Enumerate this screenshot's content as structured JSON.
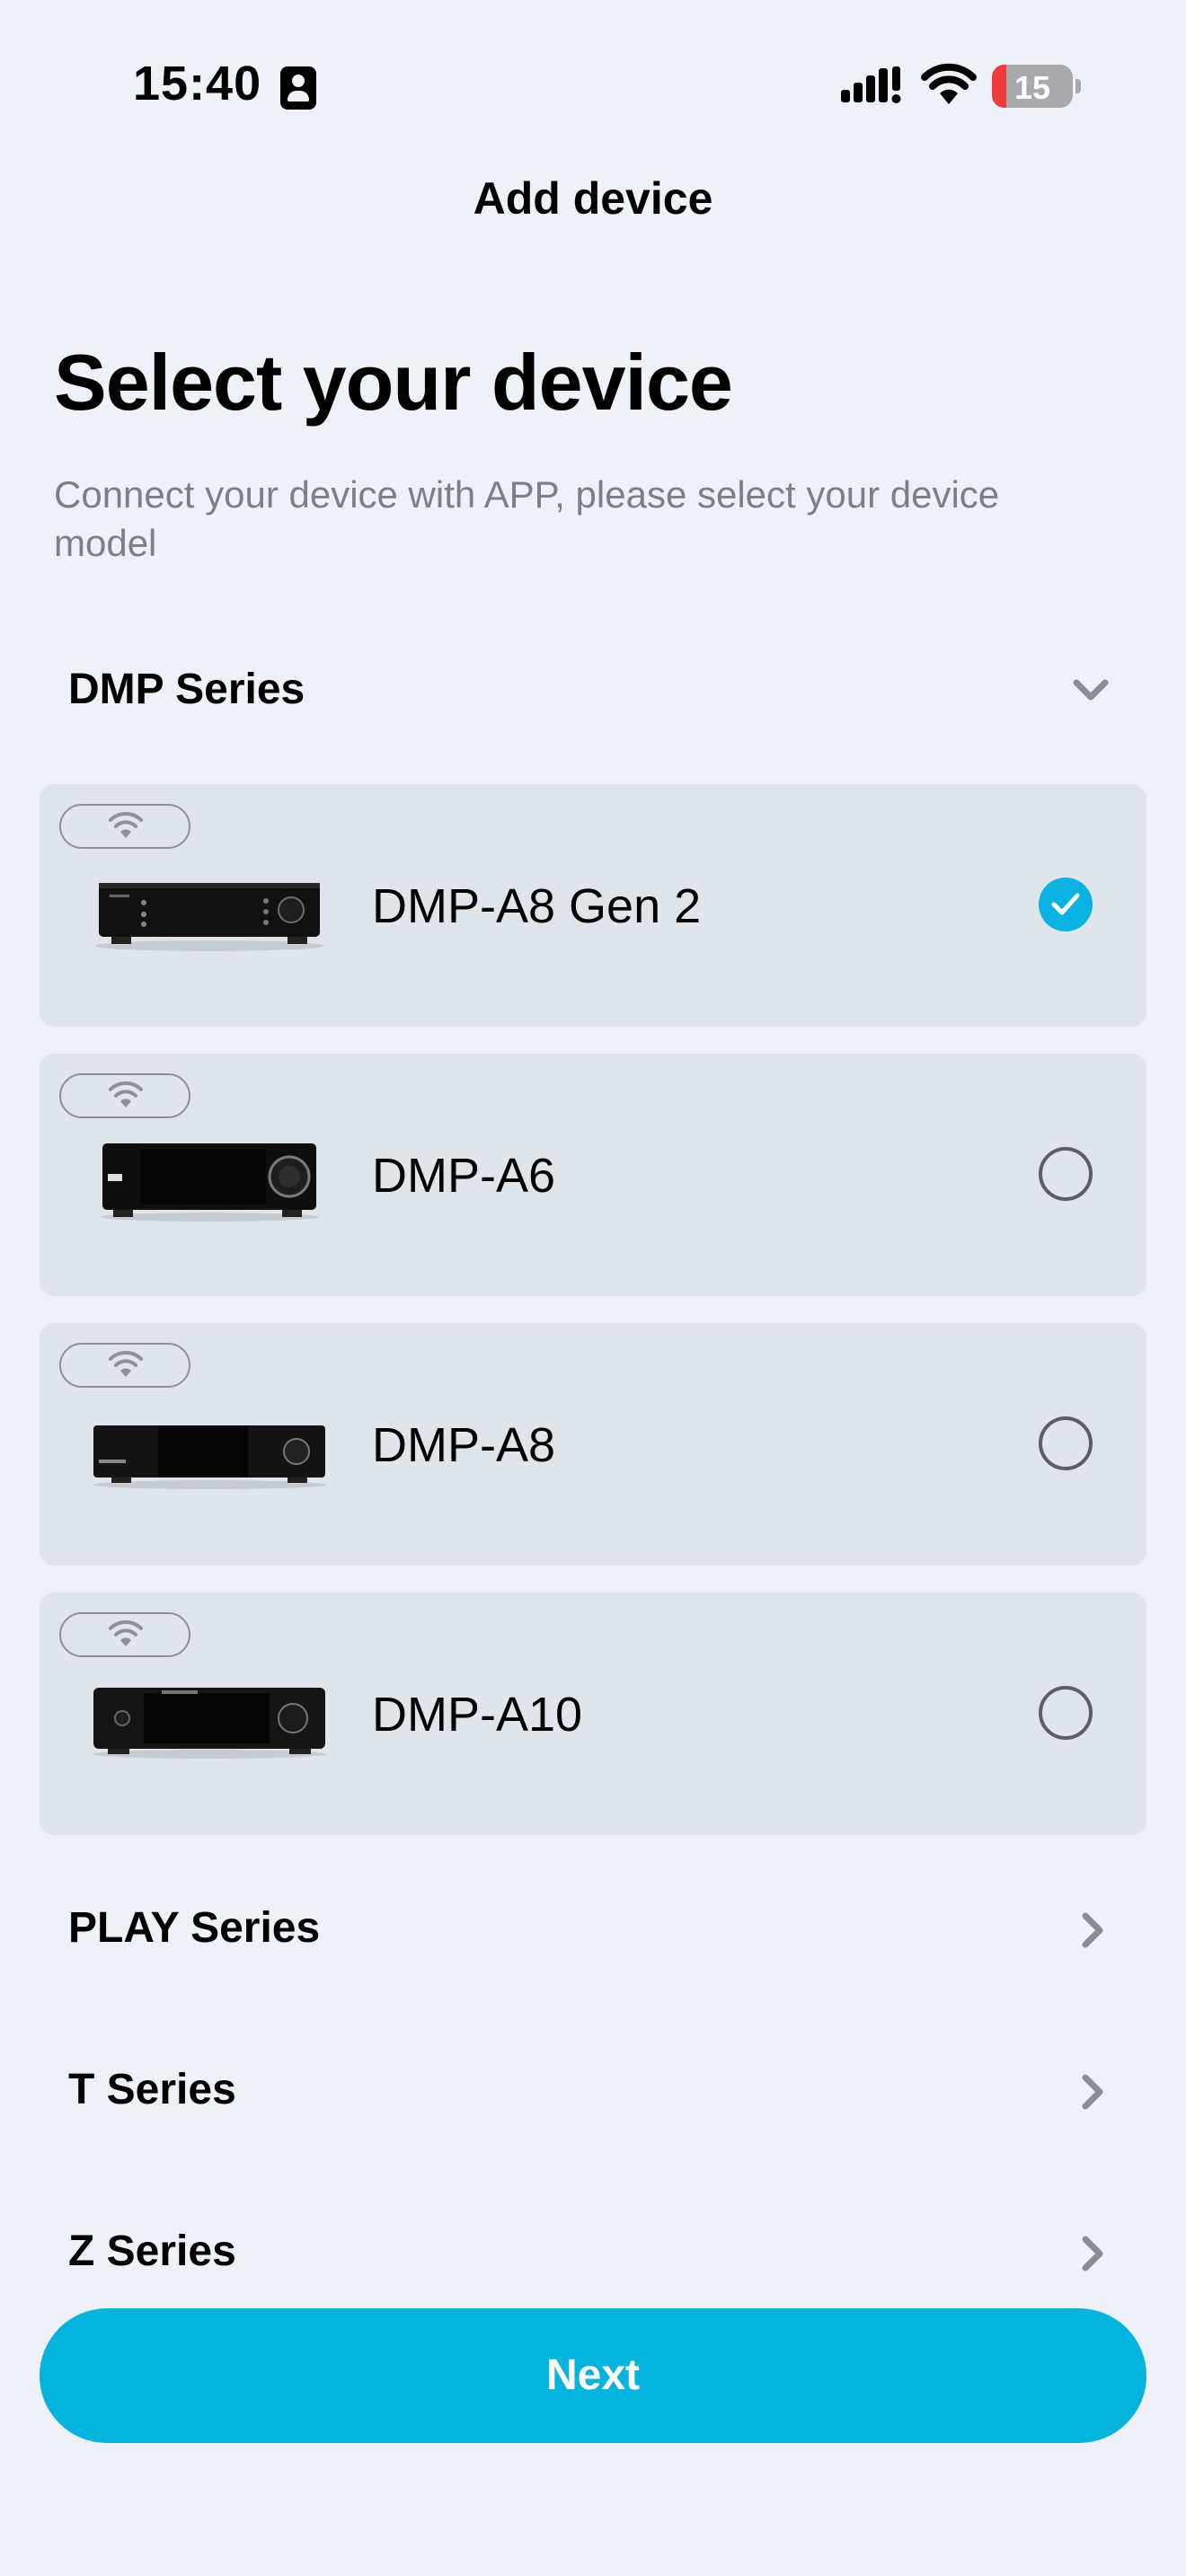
{
  "status_bar": {
    "time": "15:40",
    "battery": "15",
    "battery_level_percent": 15,
    "icons": [
      "contact-card-icon",
      "signal-icon",
      "wifi-icon",
      "battery-icon"
    ]
  },
  "nav": {
    "title": "Add device"
  },
  "heading": "Select your device",
  "subtext": "Connect your device with APP, please select your device model",
  "series": [
    {
      "label": "DMP Series",
      "state": "expanded",
      "icon": "chevron-down-icon"
    },
    {
      "label": "PLAY Series",
      "state": "collapsed",
      "icon": "chevron-right-icon"
    },
    {
      "label": "T Series",
      "state": "collapsed",
      "icon": "chevron-right-icon"
    },
    {
      "label": "Z Series",
      "state": "collapsed",
      "icon": "chevron-right-icon"
    }
  ],
  "devices": [
    {
      "name": "DMP-A8 Gen 2",
      "selected": true,
      "connectivity_icon": "wifi-icon"
    },
    {
      "name": "DMP-A6",
      "selected": false,
      "connectivity_icon": "wifi-icon"
    },
    {
      "name": "DMP-A8",
      "selected": false,
      "connectivity_icon": "wifi-icon"
    },
    {
      "name": "DMP-A10",
      "selected": false,
      "connectivity_icon": "wifi-icon"
    }
  ],
  "next_button": {
    "label": "Next"
  },
  "colors": {
    "accent": "#04b4dd",
    "background": "#eef1f7",
    "card": "#e0e5ec",
    "muted_text": "#7d7f86"
  }
}
